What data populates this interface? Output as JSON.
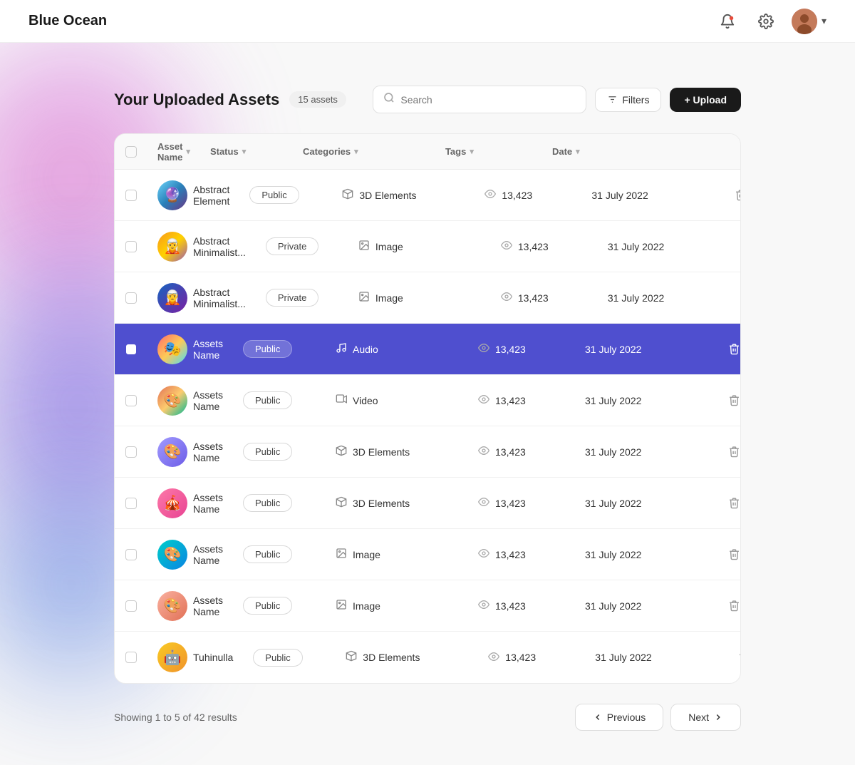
{
  "brand": "Blue Ocean",
  "navbar": {
    "bell_icon": "🔔",
    "gear_icon": "⚙",
    "chevron_down": "▾"
  },
  "page": {
    "title": "Your Uploaded Assets",
    "asset_count": "15 assets",
    "search_placeholder": "Search",
    "filter_label": "Filters",
    "upload_label": "+ Upload"
  },
  "table": {
    "headers": [
      {
        "id": "checkbox",
        "label": ""
      },
      {
        "id": "asset-name",
        "label": "Asset Name"
      },
      {
        "id": "status",
        "label": "Status"
      },
      {
        "id": "categories",
        "label": "Categories"
      },
      {
        "id": "tags",
        "label": "Tags"
      },
      {
        "id": "date",
        "label": "Date"
      },
      {
        "id": "actions",
        "label": ""
      }
    ],
    "rows": [
      {
        "id": 1,
        "selected": false,
        "thumb_class": "thumb-abstract1",
        "thumb_emoji": "🔮",
        "name": "Abstract Element",
        "status": "Public",
        "category": "3D Elements",
        "category_icon": "cube",
        "tags": "13,423",
        "date": "31 July 2022"
      },
      {
        "id": 2,
        "selected": false,
        "thumb_class": "thumb-abstract2",
        "thumb_emoji": "🧝",
        "name": "Abstract Minimalist...",
        "status": "Private",
        "category": "Image",
        "category_icon": "image",
        "tags": "13,423",
        "date": "31 July 2022"
      },
      {
        "id": 3,
        "selected": false,
        "thumb_class": "thumb-abstract3",
        "thumb_emoji": "🧝",
        "name": "Abstract Minimalist...",
        "status": "Private",
        "category": "Image",
        "category_icon": "image",
        "tags": "13,423",
        "date": "31 July 2022"
      },
      {
        "id": 4,
        "selected": true,
        "thumb_class": "thumb-assets4",
        "thumb_emoji": "🎭",
        "name": "Assets Name",
        "status": "Public",
        "category": "Audio",
        "category_icon": "audio",
        "tags": "13,423",
        "date": "31 July 2022"
      },
      {
        "id": 5,
        "selected": false,
        "thumb_class": "thumb-assets5",
        "thumb_emoji": "🎨",
        "name": "Assets Name",
        "status": "Public",
        "category": "Video",
        "category_icon": "video",
        "tags": "13,423",
        "date": "31 July 2022"
      },
      {
        "id": 6,
        "selected": false,
        "thumb_class": "thumb-assets6",
        "thumb_emoji": "🎨",
        "name": "Assets Name",
        "status": "Public",
        "category": "3D Elements",
        "category_icon": "cube",
        "tags": "13,423",
        "date": "31 July 2022"
      },
      {
        "id": 7,
        "selected": false,
        "thumb_class": "thumb-assets7",
        "thumb_emoji": "🎪",
        "name": "Assets Name",
        "status": "Public",
        "category": "3D Elements",
        "category_icon": "cube",
        "tags": "13,423",
        "date": "31 July 2022"
      },
      {
        "id": 8,
        "selected": false,
        "thumb_class": "thumb-assets8",
        "thumb_emoji": "🎨",
        "name": "Assets Name",
        "status": "Public",
        "category": "Image",
        "category_icon": "image",
        "tags": "13,423",
        "date": "31 July 2022"
      },
      {
        "id": 9,
        "selected": false,
        "thumb_class": "thumb-assets9",
        "thumb_emoji": "🎨",
        "name": "Assets Name",
        "status": "Public",
        "category": "Image",
        "category_icon": "image",
        "tags": "13,423",
        "date": "31 July 2022"
      },
      {
        "id": 10,
        "selected": false,
        "thumb_class": "thumb-tuhinulla",
        "thumb_emoji": "🤖",
        "name": "Tuhinulla",
        "status": "Public",
        "category": "3D Elements",
        "category_icon": "cube",
        "tags": "13,423",
        "date": "31 July 2022"
      }
    ]
  },
  "pagination": {
    "showing_text": "Showing 1 to 5 of 42 results",
    "previous_label": "Previous",
    "next_label": "Next"
  }
}
